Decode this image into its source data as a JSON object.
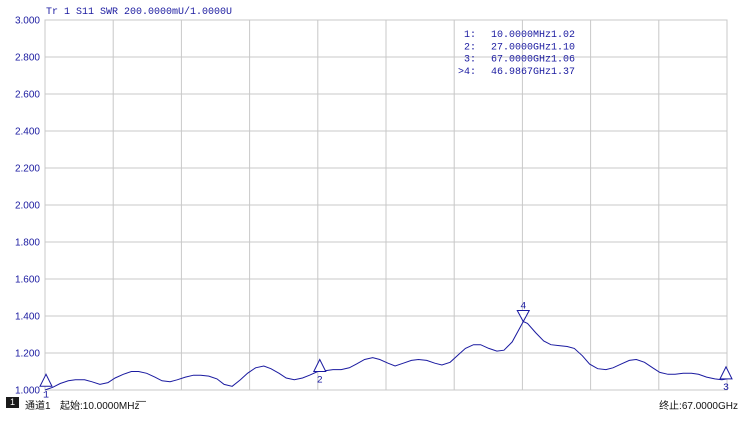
{
  "trace_header": "Tr 1  S11 SWR 200.0000mU/1.0000U",
  "chart_data": {
    "type": "line",
    "title": "",
    "xlabel": "",
    "ylabel": "",
    "ylim": [
      1.0,
      3.0
    ],
    "xlim_ghz": [
      0.01,
      67.0
    ],
    "y_ticks": [
      "3.000",
      "2.800",
      "2.600",
      "2.400",
      "2.200",
      "2.000",
      "1.800",
      "1.600",
      "1.400",
      "1.200",
      "1.000"
    ],
    "grid": true,
    "x_divisions": 10,
    "series": [
      {
        "color": "#1a1aa0",
        "x": [
          0.01,
          0.8,
          1.5,
          2.3,
          3.0,
          3.9,
          4.6,
          5.4,
          6.2,
          6.9,
          7.7,
          8.5,
          9.2,
          10.0,
          10.8,
          11.5,
          12.3,
          13.0,
          13.8,
          14.6,
          15.3,
          16.1,
          16.9,
          17.6,
          18.4,
          19.2,
          19.9,
          20.7,
          21.5,
          22.2,
          23.0,
          23.7,
          24.5,
          25.3,
          26.0,
          26.8,
          27.0,
          27.6,
          28.3,
          29.1,
          29.9,
          30.6,
          31.4,
          32.2,
          32.9,
          33.7,
          34.4,
          35.2,
          36.0,
          36.7,
          37.5,
          38.3,
          39.0,
          39.8,
          40.6,
          41.3,
          42.1,
          42.8,
          43.6,
          44.4,
          45.1,
          45.9,
          46.99,
          47.4,
          48.2,
          49.0,
          49.7,
          50.5,
          51.3,
          52.0,
          52.8,
          53.5,
          54.3,
          55.1,
          55.8,
          56.6,
          57.4,
          58.1,
          58.9,
          59.7,
          60.4,
          61.2,
          61.9,
          62.7,
          63.5,
          64.2,
          65.0,
          65.8,
          66.5,
          67.0
        ],
        "y": [
          1.0,
          1.015,
          1.035,
          1.05,
          1.055,
          1.055,
          1.045,
          1.03,
          1.04,
          1.065,
          1.085,
          1.1,
          1.1,
          1.09,
          1.07,
          1.05,
          1.045,
          1.055,
          1.07,
          1.08,
          1.08,
          1.075,
          1.06,
          1.03,
          1.02,
          1.055,
          1.09,
          1.12,
          1.13,
          1.115,
          1.09,
          1.065,
          1.055,
          1.065,
          1.08,
          1.1,
          1.1,
          1.105,
          1.11,
          1.11,
          1.12,
          1.14,
          1.165,
          1.175,
          1.165,
          1.145,
          1.13,
          1.145,
          1.16,
          1.165,
          1.16,
          1.145,
          1.135,
          1.15,
          1.19,
          1.225,
          1.245,
          1.245,
          1.225,
          1.21,
          1.215,
          1.26,
          1.37,
          1.36,
          1.31,
          1.265,
          1.245,
          1.24,
          1.235,
          1.225,
          1.185,
          1.14,
          1.115,
          1.11,
          1.12,
          1.14,
          1.16,
          1.165,
          1.15,
          1.12,
          1.095,
          1.085,
          1.085,
          1.09,
          1.09,
          1.085,
          1.07,
          1.06,
          1.055,
          1.06
        ]
      }
    ],
    "markers": [
      {
        "id": "1",
        "label": "1:",
        "freq": "10.0000MHz",
        "value": "1.02",
        "x": 0.01,
        "y": 1.02,
        "active": false
      },
      {
        "id": "2",
        "label": "2:",
        "freq": "27.0000GHz",
        "value": "1.10",
        "x": 27.0,
        "y": 1.1,
        "active": false
      },
      {
        "id": "3",
        "label": "3:",
        "freq": "67.0000GHz",
        "value": "1.06",
        "x": 67.0,
        "y": 1.06,
        "active": false
      },
      {
        "id": "4",
        "label": ">4:",
        "freq": "46.9867GHz",
        "value": "1.37",
        "x": 46.9867,
        "y": 1.37,
        "active": true
      }
    ]
  },
  "status": {
    "channel_num": "1",
    "channel_label": "通道1",
    "start_label": "起始:10.0000MHz",
    "start_suffix": "—",
    "stop_label": "终止:67.0000GHz"
  }
}
